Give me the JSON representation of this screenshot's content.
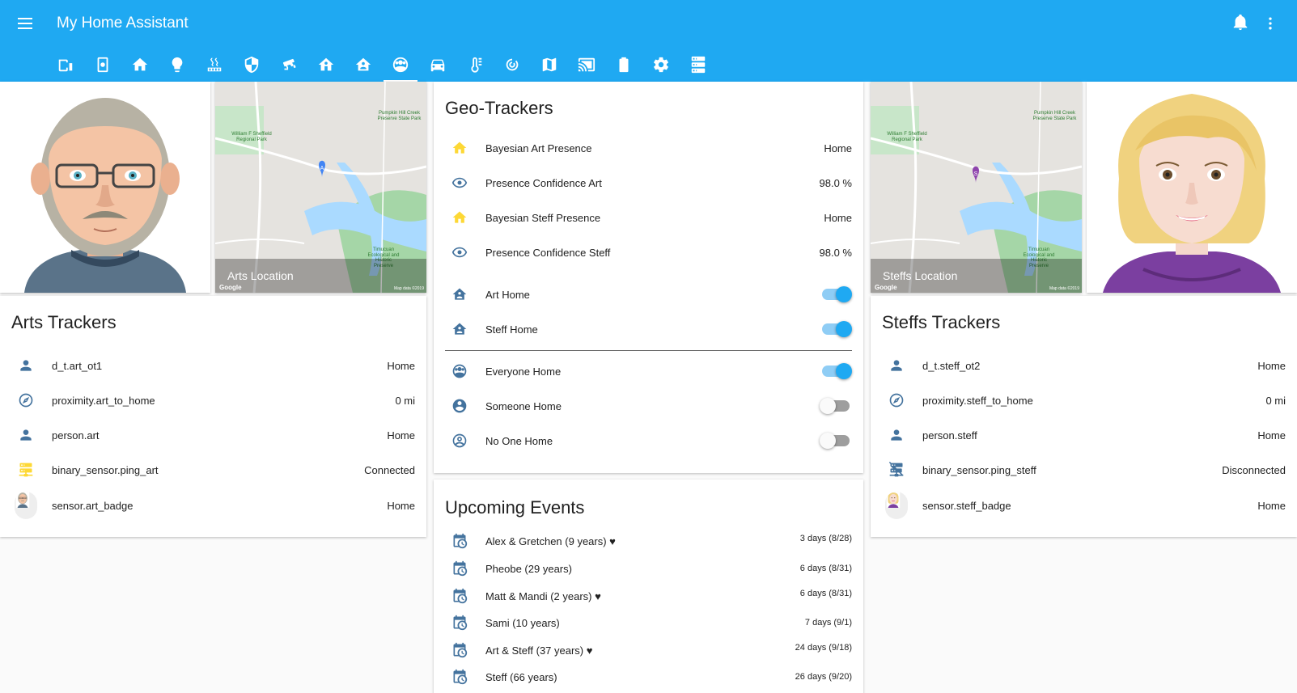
{
  "header": {
    "title": "My Home Assistant",
    "tabs": [
      {
        "icon": "tablet-cellphone-icon"
      },
      {
        "icon": "cellphone-cog-icon"
      },
      {
        "icon": "home-icon"
      },
      {
        "icon": "lightbulb-icon"
      },
      {
        "icon": "radiator-icon"
      },
      {
        "icon": "shield-icon"
      },
      {
        "icon": "cctv-icon"
      },
      {
        "icon": "home-variant-icon"
      },
      {
        "icon": "home-account-icon"
      },
      {
        "icon": "account-group-icon",
        "active": true
      },
      {
        "icon": "car-icon"
      },
      {
        "icon": "thermometer-lines-icon"
      },
      {
        "icon": "radar-icon"
      },
      {
        "icon": "map-icon"
      },
      {
        "icon": "cast-connected-icon"
      },
      {
        "icon": "battery-icon"
      },
      {
        "icon": "settings-icon"
      },
      {
        "icon": "server-icon"
      }
    ]
  },
  "art_location": {
    "caption": "Arts Location",
    "google": "Google",
    "map_data": "Map data ©2019",
    "park1": "William F Sheffield Regional Park",
    "park2": "Pumpkin Hill Creek Preserve State Park",
    "park3": "Timucuan Ecological and Historic Preserve",
    "marker": "A"
  },
  "steff_location": {
    "caption": "Steffs Location",
    "google": "Google",
    "map_data": "Map data ©2019",
    "park1": "William F Sheffield Regional Park",
    "park2": "Pumpkin Hill Creek Preserve State Park",
    "park3": "Timucuan Ecological and Historic Preserve",
    "marker": "S"
  },
  "arts_trackers": {
    "title": "Arts Trackers",
    "rows": [
      {
        "icon": "account-icon",
        "name": "d_t.art_ot1",
        "state": "Home"
      },
      {
        "icon": "compass-icon",
        "name": "proximity.art_to_home",
        "state": "0 mi"
      },
      {
        "icon": "account-icon",
        "name": "person.art",
        "state": "Home"
      },
      {
        "icon": "server-network-icon",
        "name": "binary_sensor.ping_art",
        "state": "Connected",
        "color": "#fdd835"
      },
      {
        "icon": "avatar-art",
        "name": "sensor.art_badge",
        "state": "Home"
      }
    ]
  },
  "steffs_trackers": {
    "title": "Steffs Trackers",
    "rows": [
      {
        "icon": "account-icon",
        "name": "d_t.steff_ot2",
        "state": "Home"
      },
      {
        "icon": "compass-icon",
        "name": "proximity.steff_to_home",
        "state": "0 mi"
      },
      {
        "icon": "account-icon",
        "name": "person.steff",
        "state": "Home"
      },
      {
        "icon": "server-network-off-icon",
        "name": "binary_sensor.ping_steff",
        "state": "Disconnected"
      },
      {
        "icon": "avatar-steff",
        "name": "sensor.steff_badge",
        "state": "Home"
      }
    ]
  },
  "geo_trackers": {
    "title": "Geo-Trackers",
    "sensors": [
      {
        "icon": "home-icon",
        "name": "Bayesian Art Presence",
        "state": "Home",
        "color": "#fdd835"
      },
      {
        "icon": "eye-icon",
        "name": "Presence Confidence Art",
        "state": "98.0 %"
      },
      {
        "icon": "home-icon",
        "name": "Bayesian Steff Presence",
        "state": "Home",
        "color": "#fdd835"
      },
      {
        "icon": "eye-icon",
        "name": "Presence Confidence Steff",
        "state": "98.0 %"
      }
    ],
    "switches": [
      {
        "icon": "home-account-icon",
        "name": "Art Home",
        "on": true
      },
      {
        "icon": "home-account-icon",
        "name": "Steff Home",
        "on": true
      }
    ],
    "groups": [
      {
        "icon": "account-group-icon",
        "name": "Everyone Home",
        "on": true
      },
      {
        "icon": "account-circle-icon",
        "name": "Someone Home",
        "on": false
      },
      {
        "icon": "account-circle-outline-icon",
        "name": "No One Home",
        "on": false
      }
    ]
  },
  "upcoming_events": {
    "title": "Upcoming Events",
    "events": [
      {
        "name": "Alex & Gretchen (9 years) ♥",
        "when": "3 days (8/28)"
      },
      {
        "name": "Pheobe (29 years)",
        "when": "6 days (8/31)"
      },
      {
        "name": "Matt & Mandi (2 years) ♥",
        "when": "6 days (8/31)"
      },
      {
        "name": "Sami (10 years)",
        "when": "7 days (9/1)"
      },
      {
        "name": "Art & Steff (37 years) ♥",
        "when": "24 days (9/18)"
      },
      {
        "name": "Steff (66 years)",
        "when": "26 days (9/20)"
      }
    ]
  },
  "colors": {
    "primary": "#1fa9f2",
    "icon": "#44739e",
    "active_icon": "#fdd835"
  }
}
